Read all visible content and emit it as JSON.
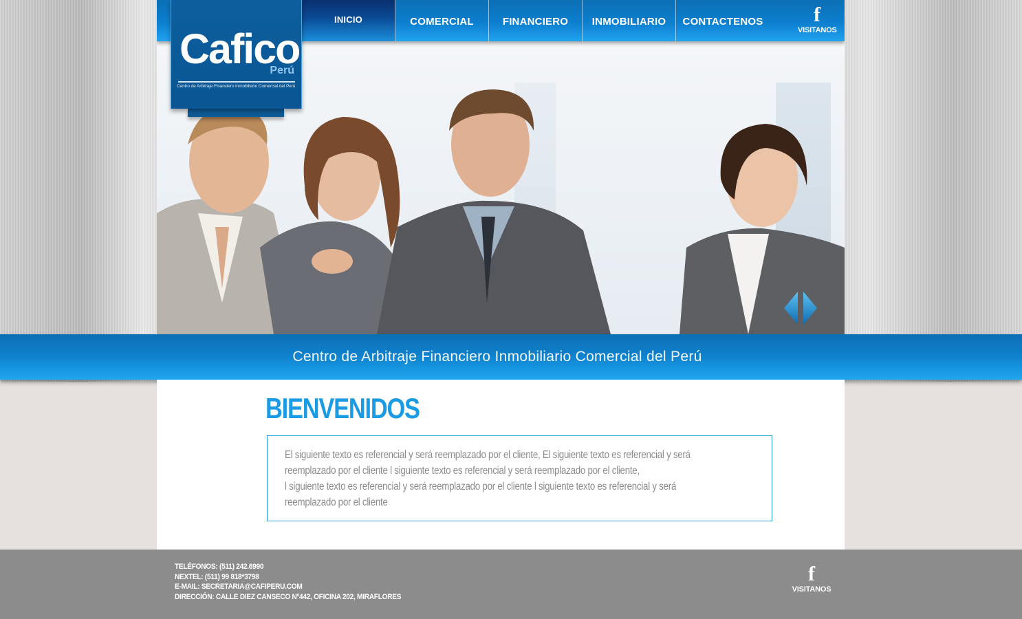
{
  "brand": {
    "name": "Cafico",
    "country": "Perú",
    "subtitle": "Centro de Arbitraje Financiero Inmobiliario Comercial del Perú"
  },
  "nav": {
    "items": [
      {
        "label": "INICIO",
        "active": true
      },
      {
        "label": "COMERCIAL",
        "active": false
      },
      {
        "label": "FINANCIERO",
        "active": false
      },
      {
        "label": "INMOBILIARIO",
        "active": false
      },
      {
        "label": "CONTACTENOS",
        "active": false
      }
    ],
    "facebook": {
      "icon": "facebook-icon",
      "label": "VISITANOS"
    }
  },
  "hero": {
    "prev_icon": "arrow-left-icon",
    "next_icon": "arrow-right-icon"
  },
  "tagline": "Centro de Arbitraje Financiero Inmobiliario Comercial del Perú",
  "main": {
    "heading": "BIENVENIDOS",
    "paragraph_lines": [
      "El siguiente texto  es referencial y será reemplazado por el cliente, El siguiente texto  es referencial y será",
      "reemplazado por el cliente l siguiente texto  es referencial y será reemplazado por el cliente,",
      "l siguiente texto  es referencial y será reemplazado por el cliente l siguiente texto  es referencial y será",
      "reemplazado por el cliente"
    ]
  },
  "footer": {
    "telefonos": "TELÉFONOS:  (511) 242.6990",
    "nextel": "NEXTEL: (511) 99 818*3798",
    "email": "E-MAIL: SECRETARIA@CAFIPERU.COM",
    "direccion": "DIRECCIÓN: CALLE DIEZ CANSECO Nº442, OFICINA 202, MIRAFLORES",
    "facebook": {
      "icon": "facebook-icon",
      "label": "VISITANOS"
    }
  },
  "colors": {
    "primary_blue": "#0f80cc",
    "light_blue": "#1ea6ee",
    "heading_blue": "#1b9be3",
    "footer_gray": "#8c8c8c",
    "body_text_gray": "#8b8b8b"
  }
}
